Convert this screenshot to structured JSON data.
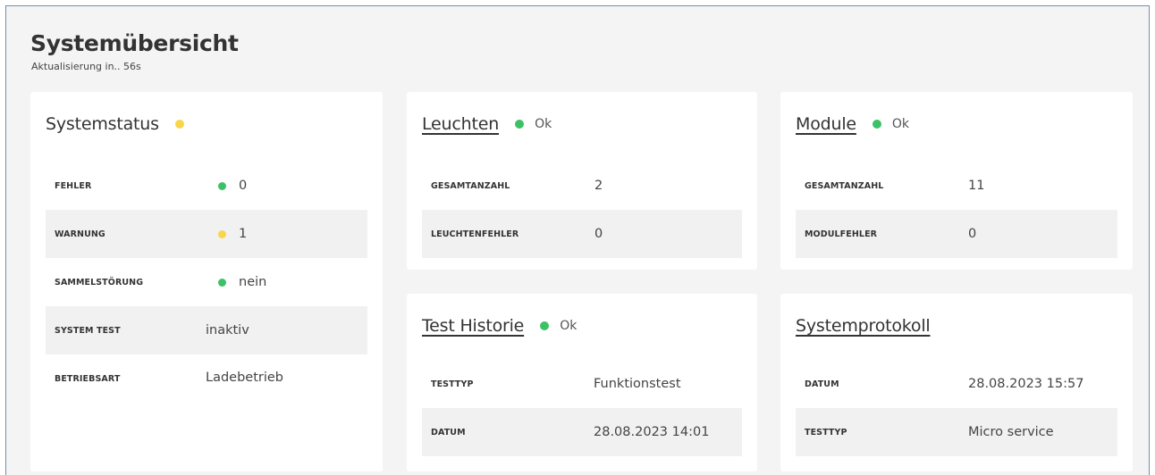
{
  "page": {
    "title": "Systemübersicht",
    "subtitle": "Aktualisierung in.. 56s"
  },
  "colors": {
    "ok": "#3cc166",
    "warning": "#f9d54a"
  },
  "systemstatus": {
    "title": "Systemstatus",
    "indicator": "yellow",
    "rows": [
      {
        "label": "FEHLER",
        "value": "0",
        "dot": "green"
      },
      {
        "label": "WARNUNG",
        "value": "1",
        "dot": "yellow"
      },
      {
        "label": "SAMMELSTÖRUNG",
        "value": "nein",
        "dot": "green"
      },
      {
        "label": "SYSTEM TEST",
        "value": "inaktiv"
      },
      {
        "label": "BETRIEBSART",
        "value": "Ladebetrieb"
      }
    ]
  },
  "leuchten": {
    "title": "Leuchten",
    "status": "Ok",
    "rows": [
      {
        "label": "GESAMTANZAHL",
        "value": "2"
      },
      {
        "label": "LEUCHTENFEHLER",
        "value": "0"
      }
    ]
  },
  "module": {
    "title": "Module",
    "status": "Ok",
    "rows": [
      {
        "label": "GESAMTANZAHL",
        "value": "11"
      },
      {
        "label": "MODULFEHLER",
        "value": "0"
      }
    ]
  },
  "test_historie": {
    "title": "Test Historie",
    "status": "Ok",
    "rows": [
      {
        "label": "TESTTYP",
        "value": "Funktionstest"
      },
      {
        "label": "DATUM",
        "value": "28.08.2023 14:01"
      }
    ]
  },
  "systemprotokoll": {
    "title": "Systemprotokoll",
    "rows": [
      {
        "label": "DATUM",
        "value": "28.08.2023 15:57"
      },
      {
        "label": "TESTTYP",
        "value": "Micro service"
      }
    ]
  }
}
